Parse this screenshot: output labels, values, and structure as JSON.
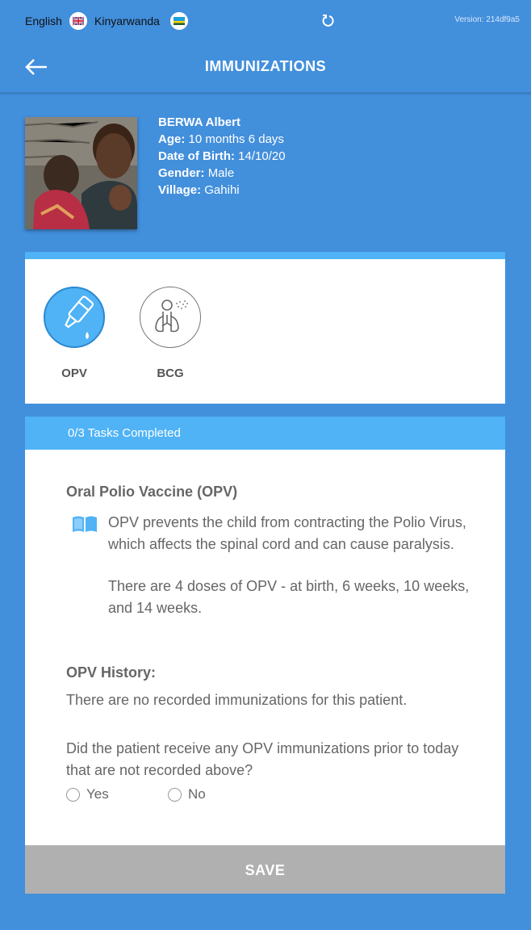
{
  "topbar": {
    "lang_english": "English",
    "lang_kinyarwanda": "Kinyarwanda",
    "version": "Version: 214df9a5"
  },
  "header": {
    "title": "IMMUNIZATIONS"
  },
  "patient": {
    "name": "BERWA Albert",
    "age_label": "Age:",
    "age": "10 months 6 days",
    "dob_label": "Date of Birth:",
    "dob": "14/10/20",
    "gender_label": "Gender:",
    "gender": "Male",
    "village_label": "Village:",
    "village": "Gahihi"
  },
  "vaccines": [
    {
      "label": "OPV",
      "selected": true,
      "icon": "dropper-icon"
    },
    {
      "label": "BCG",
      "selected": false,
      "icon": "lungs-icon"
    }
  ],
  "tasks": {
    "status": "0/3 Tasks Completed"
  },
  "info": {
    "title": "Oral Polio Vaccine (OPV)",
    "para1": "OPV prevents the child from contracting the Polio Virus, which affects the spinal cord and can cause paralysis.",
    "para2": "There are 4 doses of OPV - at birth, 6 weeks, 10 weeks, and 14 weeks.",
    "history_title": "OPV History:",
    "history_text": "There are no recorded immunizations for this patient.",
    "question": "Did the patient receive any OPV immunizations prior to today that are not recorded above?",
    "yes": "Yes",
    "no": "No"
  },
  "save_label": "SAVE",
  "colors": {
    "background": "#428fdc",
    "accent": "#4fb3f6",
    "save": "#b0b0b0"
  }
}
